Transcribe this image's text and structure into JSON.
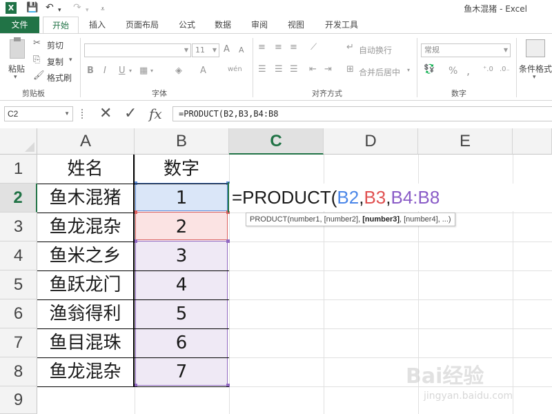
{
  "window": {
    "title": "鱼木混猪 - Excel",
    "logo": "X",
    "qa_icons": [
      "save-icon",
      "undo-icon",
      "redo-icon",
      "customize-icon"
    ]
  },
  "tabs": [
    {
      "label": "文件"
    },
    {
      "label": "开始",
      "active": true
    },
    {
      "label": "插入"
    },
    {
      "label": "页面布局"
    },
    {
      "label": "公式"
    },
    {
      "label": "数据"
    },
    {
      "label": "审阅"
    },
    {
      "label": "视图"
    },
    {
      "label": "开发工具"
    }
  ],
  "ribbon": {
    "clipboard": {
      "paste": "粘贴",
      "cut": "剪切",
      "copy": "复制",
      "format_painter": "格式刷",
      "label": "剪贴板"
    },
    "font": {
      "font_name": "",
      "font_size": "11",
      "label": "字体",
      "bold": "B",
      "italic": "I",
      "underline": "U",
      "grow": "A",
      "shrink": "A",
      "font_color": "A",
      "phonetic": "wén"
    },
    "alignment": {
      "wrap_text": "自动换行",
      "merge_center": "合并后居中",
      "label": "对齐方式"
    },
    "number": {
      "format": "常规",
      "percent": "%",
      "comma": ",",
      "label": "数字"
    },
    "styles": {
      "conditional_format": "条件格式"
    }
  },
  "formula_bar": {
    "name_box": "C2",
    "cancel": "✕",
    "enter": "✓",
    "fx": "fx",
    "formula": "=PRODUCT(B2,B3,B4:B8"
  },
  "columns": [
    "A",
    "B",
    "C",
    "D",
    "E"
  ],
  "selected_column": "C",
  "rows": [
    "1",
    "2",
    "3",
    "4",
    "5",
    "6",
    "7",
    "8",
    "9"
  ],
  "selected_row": "2",
  "headers": {
    "a": "姓名",
    "b": "数字"
  },
  "data": [
    {
      "name": "鱼木混猪",
      "value": "1"
    },
    {
      "name": "鱼龙混杂",
      "value": "2"
    },
    {
      "name": "鱼米之乡",
      "value": "3"
    },
    {
      "name": "鱼跃龙门",
      "value": "4"
    },
    {
      "name": "渔翁得利",
      "value": "5"
    },
    {
      "name": "鱼目混珠",
      "value": "6"
    },
    {
      "name": "鱼龙混杂",
      "value": "7"
    }
  ],
  "edit_cell": {
    "prefix": "=PRODUCT(",
    "ref1": "B2",
    "comma1": ",",
    "ref2": "B3",
    "comma2": ",",
    "ref3": "B4:B8"
  },
  "tooltip": {
    "pre": "PRODUCT(number1, [number2], ",
    "bold": "[number3]",
    "post": ", [number4], ...)"
  },
  "watermark": {
    "main": "Bai经验",
    "sub": "jingyan.baidu.com"
  },
  "colors": {
    "excel_green": "#217346",
    "ref_blue": "#4a86e8",
    "ref_red": "#e05050",
    "ref_purple": "#8a5cc7"
  }
}
